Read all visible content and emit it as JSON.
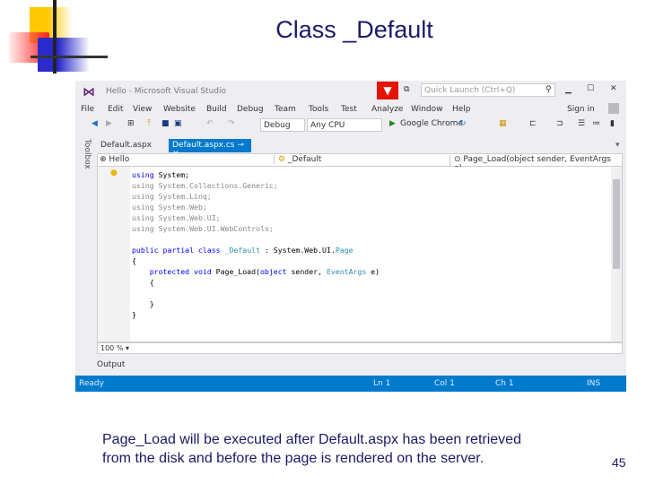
{
  "slide": {
    "title": "Class _Default",
    "caption_lines": [
      "Page_Load will be executed after Default.aspx has been retrieved",
      "from the disk and before the page is rendered on the server."
    ],
    "page_number": "45"
  },
  "vs": {
    "window_title": "Hello - Microsoft Visual Studio",
    "quick_launch_placeholder": "Quick Launch (Ctrl+Q)",
    "menu": [
      "File",
      "Edit",
      "View",
      "Website",
      "Build",
      "Debug",
      "Team",
      "Tools",
      "Test",
      "Analyze",
      "Window",
      "Help"
    ],
    "sign_in": "Sign in",
    "config": "Debug",
    "platform": "Any CPU",
    "run_target": "Google Chrome",
    "toolbox_label": "Toolbox",
    "tabs": [
      {
        "label": "Default.aspx",
        "active": false
      },
      {
        "label": "Default.aspx.cs",
        "active": true
      }
    ],
    "nav": {
      "project": "Hello",
      "class": "_Default",
      "member": "Page_Load(object sender, EventArgs e)"
    },
    "code": [
      [
        [
          "kw",
          "using"
        ],
        [
          "pl",
          " System;"
        ]
      ],
      [
        [
          "gr",
          "using"
        ],
        [
          "gr",
          " System.Collections.Generic;"
        ]
      ],
      [
        [
          "gr",
          "using"
        ],
        [
          "gr",
          " System.Linq;"
        ]
      ],
      [
        [
          "gr",
          "using"
        ],
        [
          "gr",
          " System.Web;"
        ]
      ],
      [
        [
          "gr",
          "using"
        ],
        [
          "gr",
          " System.Web.UI;"
        ]
      ],
      [
        [
          "gr",
          "using"
        ],
        [
          "gr",
          " System.Web.UI.WebControls;"
        ]
      ],
      [],
      [
        [
          "kw",
          "public"
        ],
        [
          "pl",
          " "
        ],
        [
          "kw",
          "partial"
        ],
        [
          "pl",
          " "
        ],
        [
          "kw",
          "class"
        ],
        [
          "pl",
          " "
        ],
        [
          "ty",
          "_Default"
        ],
        [
          "pl",
          " : System.Web.UI."
        ],
        [
          "ty",
          "Page"
        ]
      ],
      [
        [
          "pl",
          "{"
        ]
      ],
      [
        [
          "pl",
          "    "
        ],
        [
          "kw",
          "protected"
        ],
        [
          "pl",
          " "
        ],
        [
          "kw",
          "void"
        ],
        [
          "pl",
          " Page_Load("
        ],
        [
          "kw",
          "object"
        ],
        [
          "pl",
          " sender, "
        ],
        [
          "ty",
          "EventArgs"
        ],
        [
          "pl",
          " e)"
        ]
      ],
      [
        [
          "pl",
          "    {"
        ]
      ],
      [],
      [
        [
          "pl",
          "    }"
        ]
      ],
      [
        [
          "pl",
          "}"
        ]
      ]
    ],
    "zoom_level": "100 %",
    "output_label": "Output",
    "status": {
      "text": "Ready",
      "ln": "Ln 1",
      "col": "Col 1",
      "ch": "Ch 1",
      "mode": "INS"
    },
    "colors": {
      "status_bar": "#007acc",
      "vs_purple": "#68217a",
      "keyword": "#0000ff",
      "type": "#2b91af"
    }
  }
}
